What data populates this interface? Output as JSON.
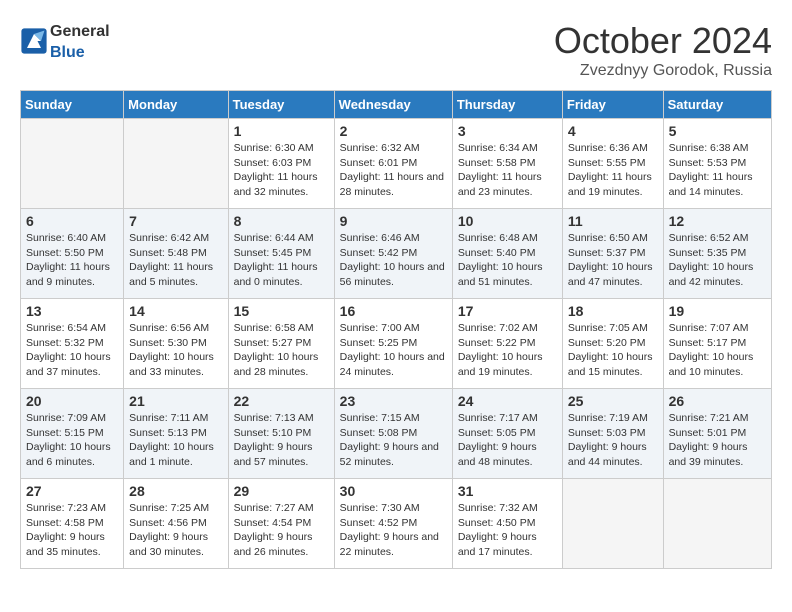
{
  "header": {
    "logo_general": "General",
    "logo_blue": "Blue",
    "month": "October 2024",
    "location": "Zvezdnyy Gorodok, Russia"
  },
  "columns": [
    "Sunday",
    "Monday",
    "Tuesday",
    "Wednesday",
    "Thursday",
    "Friday",
    "Saturday"
  ],
  "weeks": [
    [
      {
        "day": "",
        "sunrise": "",
        "sunset": "",
        "daylight": "",
        "empty": true
      },
      {
        "day": "",
        "sunrise": "",
        "sunset": "",
        "daylight": "",
        "empty": true
      },
      {
        "day": "1",
        "sunrise": "Sunrise: 6:30 AM",
        "sunset": "Sunset: 6:03 PM",
        "daylight": "Daylight: 11 hours and 32 minutes."
      },
      {
        "day": "2",
        "sunrise": "Sunrise: 6:32 AM",
        "sunset": "Sunset: 6:01 PM",
        "daylight": "Daylight: 11 hours and 28 minutes."
      },
      {
        "day": "3",
        "sunrise": "Sunrise: 6:34 AM",
        "sunset": "Sunset: 5:58 PM",
        "daylight": "Daylight: 11 hours and 23 minutes."
      },
      {
        "day": "4",
        "sunrise": "Sunrise: 6:36 AM",
        "sunset": "Sunset: 5:55 PM",
        "daylight": "Daylight: 11 hours and 19 minutes."
      },
      {
        "day": "5",
        "sunrise": "Sunrise: 6:38 AM",
        "sunset": "Sunset: 5:53 PM",
        "daylight": "Daylight: 11 hours and 14 minutes."
      }
    ],
    [
      {
        "day": "6",
        "sunrise": "Sunrise: 6:40 AM",
        "sunset": "Sunset: 5:50 PM",
        "daylight": "Daylight: 11 hours and 9 minutes."
      },
      {
        "day": "7",
        "sunrise": "Sunrise: 6:42 AM",
        "sunset": "Sunset: 5:48 PM",
        "daylight": "Daylight: 11 hours and 5 minutes."
      },
      {
        "day": "8",
        "sunrise": "Sunrise: 6:44 AM",
        "sunset": "Sunset: 5:45 PM",
        "daylight": "Daylight: 11 hours and 0 minutes."
      },
      {
        "day": "9",
        "sunrise": "Sunrise: 6:46 AM",
        "sunset": "Sunset: 5:42 PM",
        "daylight": "Daylight: 10 hours and 56 minutes."
      },
      {
        "day": "10",
        "sunrise": "Sunrise: 6:48 AM",
        "sunset": "Sunset: 5:40 PM",
        "daylight": "Daylight: 10 hours and 51 minutes."
      },
      {
        "day": "11",
        "sunrise": "Sunrise: 6:50 AM",
        "sunset": "Sunset: 5:37 PM",
        "daylight": "Daylight: 10 hours and 47 minutes."
      },
      {
        "day": "12",
        "sunrise": "Sunrise: 6:52 AM",
        "sunset": "Sunset: 5:35 PM",
        "daylight": "Daylight: 10 hours and 42 minutes."
      }
    ],
    [
      {
        "day": "13",
        "sunrise": "Sunrise: 6:54 AM",
        "sunset": "Sunset: 5:32 PM",
        "daylight": "Daylight: 10 hours and 37 minutes."
      },
      {
        "day": "14",
        "sunrise": "Sunrise: 6:56 AM",
        "sunset": "Sunset: 5:30 PM",
        "daylight": "Daylight: 10 hours and 33 minutes."
      },
      {
        "day": "15",
        "sunrise": "Sunrise: 6:58 AM",
        "sunset": "Sunset: 5:27 PM",
        "daylight": "Daylight: 10 hours and 28 minutes."
      },
      {
        "day": "16",
        "sunrise": "Sunrise: 7:00 AM",
        "sunset": "Sunset: 5:25 PM",
        "daylight": "Daylight: 10 hours and 24 minutes."
      },
      {
        "day": "17",
        "sunrise": "Sunrise: 7:02 AM",
        "sunset": "Sunset: 5:22 PM",
        "daylight": "Daylight: 10 hours and 19 minutes."
      },
      {
        "day": "18",
        "sunrise": "Sunrise: 7:05 AM",
        "sunset": "Sunset: 5:20 PM",
        "daylight": "Daylight: 10 hours and 15 minutes."
      },
      {
        "day": "19",
        "sunrise": "Sunrise: 7:07 AM",
        "sunset": "Sunset: 5:17 PM",
        "daylight": "Daylight: 10 hours and 10 minutes."
      }
    ],
    [
      {
        "day": "20",
        "sunrise": "Sunrise: 7:09 AM",
        "sunset": "Sunset: 5:15 PM",
        "daylight": "Daylight: 10 hours and 6 minutes."
      },
      {
        "day": "21",
        "sunrise": "Sunrise: 7:11 AM",
        "sunset": "Sunset: 5:13 PM",
        "daylight": "Daylight: 10 hours and 1 minute."
      },
      {
        "day": "22",
        "sunrise": "Sunrise: 7:13 AM",
        "sunset": "Sunset: 5:10 PM",
        "daylight": "Daylight: 9 hours and 57 minutes."
      },
      {
        "day": "23",
        "sunrise": "Sunrise: 7:15 AM",
        "sunset": "Sunset: 5:08 PM",
        "daylight": "Daylight: 9 hours and 52 minutes."
      },
      {
        "day": "24",
        "sunrise": "Sunrise: 7:17 AM",
        "sunset": "Sunset: 5:05 PM",
        "daylight": "Daylight: 9 hours and 48 minutes."
      },
      {
        "day": "25",
        "sunrise": "Sunrise: 7:19 AM",
        "sunset": "Sunset: 5:03 PM",
        "daylight": "Daylight: 9 hours and 44 minutes."
      },
      {
        "day": "26",
        "sunrise": "Sunrise: 7:21 AM",
        "sunset": "Sunset: 5:01 PM",
        "daylight": "Daylight: 9 hours and 39 minutes."
      }
    ],
    [
      {
        "day": "27",
        "sunrise": "Sunrise: 7:23 AM",
        "sunset": "Sunset: 4:58 PM",
        "daylight": "Daylight: 9 hours and 35 minutes."
      },
      {
        "day": "28",
        "sunrise": "Sunrise: 7:25 AM",
        "sunset": "Sunset: 4:56 PM",
        "daylight": "Daylight: 9 hours and 30 minutes."
      },
      {
        "day": "29",
        "sunrise": "Sunrise: 7:27 AM",
        "sunset": "Sunset: 4:54 PM",
        "daylight": "Daylight: 9 hours and 26 minutes."
      },
      {
        "day": "30",
        "sunrise": "Sunrise: 7:30 AM",
        "sunset": "Sunset: 4:52 PM",
        "daylight": "Daylight: 9 hours and 22 minutes."
      },
      {
        "day": "31",
        "sunrise": "Sunrise: 7:32 AM",
        "sunset": "Sunset: 4:50 PM",
        "daylight": "Daylight: 9 hours and 17 minutes."
      },
      {
        "day": "",
        "sunrise": "",
        "sunset": "",
        "daylight": "",
        "empty": true
      },
      {
        "day": "",
        "sunrise": "",
        "sunset": "",
        "daylight": "",
        "empty": true
      }
    ]
  ]
}
